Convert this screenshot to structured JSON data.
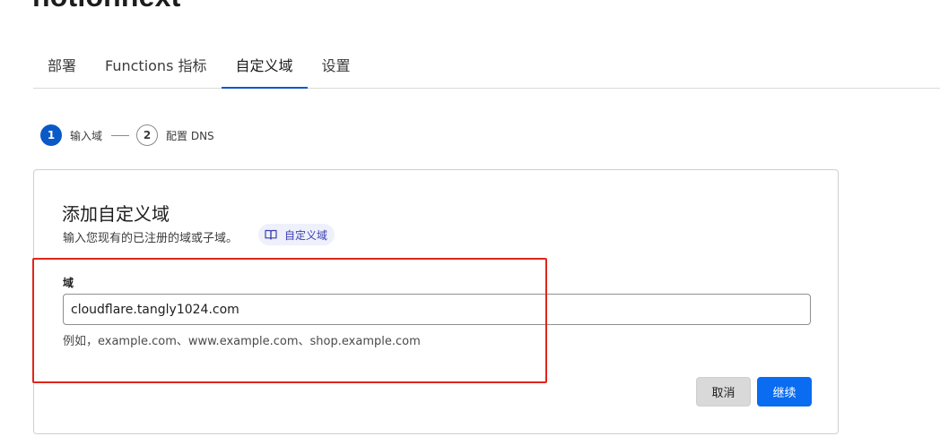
{
  "header": {
    "project_title": "notionnext"
  },
  "tabs": [
    {
      "label": "部署",
      "active": false
    },
    {
      "label": "Functions 指标",
      "active": false
    },
    {
      "label": "自定义域",
      "active": true
    },
    {
      "label": "设置",
      "active": false
    }
  ],
  "stepper": {
    "steps": [
      {
        "number": "1",
        "label": "输入域",
        "active": true
      },
      {
        "number": "2",
        "label": "配置 DNS",
        "active": false
      }
    ]
  },
  "card": {
    "title": "添加自定义域",
    "subtitle": "输入您现有的已注册的域或子域。",
    "doc_link": {
      "label": "自定义域",
      "icon": "book-icon"
    },
    "field": {
      "label": "域",
      "value": "cloudflare.tangly1024.com",
      "hint": "例如，example.com、www.example.com、shop.example.com"
    },
    "buttons": {
      "cancel_label": "取消",
      "continue_label": "继续"
    }
  },
  "colors": {
    "accent": "#0a59c7",
    "primary_button": "#0a6cf0",
    "annotation": "#e0261a"
  }
}
